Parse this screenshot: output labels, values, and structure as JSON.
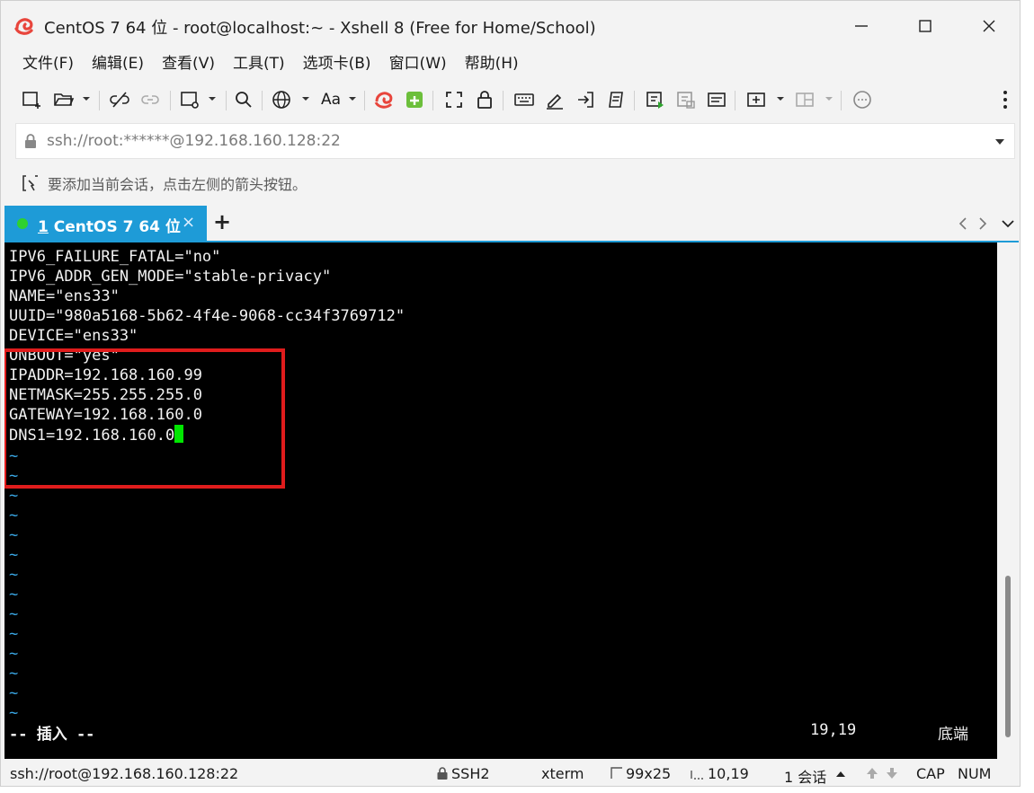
{
  "window": {
    "title": "CentOS 7 64 位 - root@localhost:~ - Xshell 8 (Free for Home/School)"
  },
  "menu": {
    "items": [
      "文件(F)",
      "编辑(E)",
      "查看(V)",
      "工具(T)",
      "选项卡(B)",
      "窗口(W)",
      "帮助(H)"
    ]
  },
  "toolbar": {
    "font_label": "Aa"
  },
  "address": {
    "url": "ssh://root:******@192.168.160.128:22"
  },
  "hint": {
    "text": "要添加当前会话，点击左侧的箭头按钮。"
  },
  "tabs": {
    "active": {
      "index": "1",
      "name": " CentOS 7 64 位"
    },
    "close": "×",
    "add": "+"
  },
  "terminal": {
    "lines": [
      "IPV6_FAILURE_FATAL=\"no\"",
      "IPV6_ADDR_GEN_MODE=\"stable-privacy\"",
      "NAME=\"ens33\"",
      "UUID=\"980a5168-5b62-4f4e-9068-cc34f3769712\"",
      "DEVICE=\"ens33\"",
      "ONBOOT=\"yes\"",
      "IPADDR=192.168.160.99",
      "NETMASK=255.255.255.0",
      "GATEWAY=192.168.160.0",
      "DNS1=192.168.160.0"
    ],
    "tilde": "~",
    "tilde_count": 14,
    "mode": "-- 插入 --",
    "position": "19,19",
    "location": "底端",
    "colors": {
      "background": "#000000",
      "text": "#f2f2f2",
      "tilde": "#3aa8e6",
      "cursor": "#00e600",
      "highlight": "#e01c1c"
    }
  },
  "statusbar": {
    "connection": "ssh://root@192.168.160.128:22",
    "protocol": "SSH2",
    "term": "xterm",
    "size": "99x25",
    "cursor": "10,19",
    "sessions": "1 会话",
    "cap": "CAP",
    "num": "NUM"
  },
  "colors": {
    "accent": "#1e9bd7",
    "logo": "#e8453c"
  }
}
